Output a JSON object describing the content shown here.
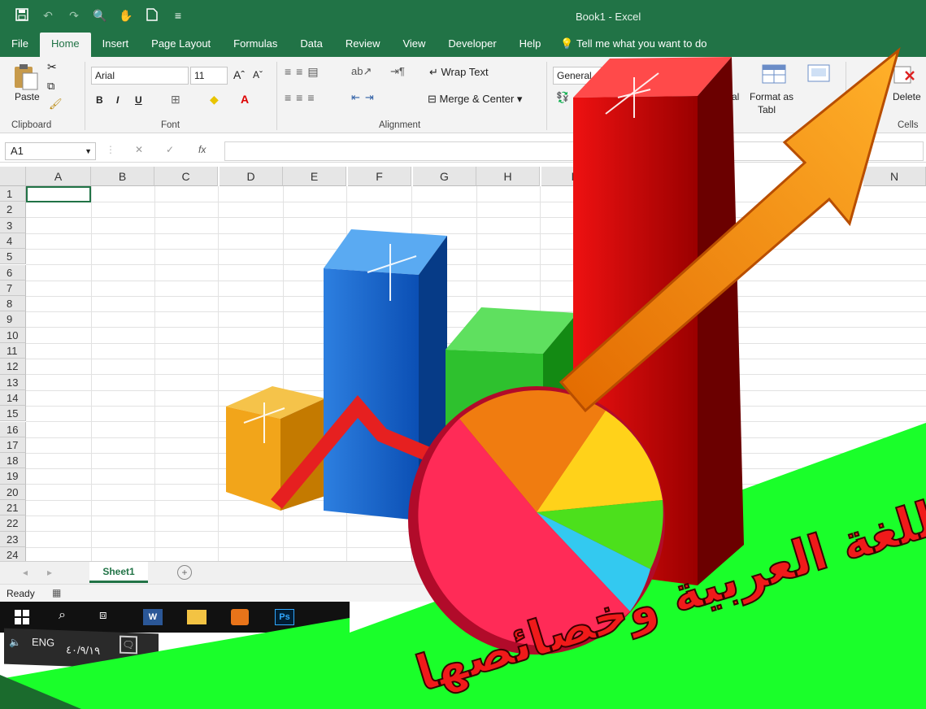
{
  "titlebar": {
    "title": "Book1 - Excel"
  },
  "tabs": [
    "File",
    "Home",
    "Insert",
    "Page Layout",
    "Formulas",
    "Data",
    "Review",
    "View",
    "Developer",
    "Help"
  ],
  "active_tab": "Home",
  "tell_me": "Tell me what you want to do",
  "ribbon": {
    "paste": "Paste",
    "clipboard": "Clipboard",
    "font_name": "Arial",
    "font_size": "11",
    "font_group": "Font",
    "bold": "B",
    "italic": "I",
    "underline": "U",
    "wrap_text": "Wrap Text",
    "merge_center": "Merge & Center",
    "alignment": "Alignment",
    "number_format": "General",
    "conditional_partial": "al",
    "format_as": "Format as",
    "table_partial": "Tabl",
    "delete": "Delete",
    "cells": "Cells"
  },
  "formula_bar": {
    "name_box": "A1",
    "fx": "fx",
    "cancel": "✕",
    "enter": "✓"
  },
  "columns": [
    "A",
    "B",
    "C",
    "D",
    "E",
    "F",
    "G",
    "H",
    "I",
    "N"
  ],
  "rows": [
    "1",
    "2",
    "3",
    "4",
    "5",
    "6",
    "7",
    "8",
    "9",
    "10",
    "11",
    "12",
    "13",
    "14",
    "15",
    "16",
    "17",
    "18",
    "19",
    "20",
    "21",
    "22",
    "23",
    "24"
  ],
  "sheet_tab": "Sheet1",
  "status": "Ready",
  "tray": {
    "lang": "ENG",
    "date": "٤٠/٩/١٩"
  },
  "overlay": {
    "title": "تقويم اللغة العربية وخصائصها"
  },
  "colors": {
    "excel_green": "#217346",
    "bg_green": "#1aff2a"
  }
}
